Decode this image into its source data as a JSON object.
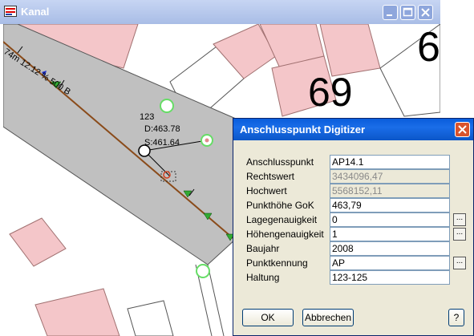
{
  "window": {
    "title": "Kanal",
    "minimize_icon": "minimize-icon",
    "maximize_icon": "maximize-icon",
    "close_icon": "close-icon"
  },
  "map": {
    "house_number_partial": "6",
    "house_number": "69",
    "pipe_label": "74m 12.12 % 500 B",
    "node_label": {
      "id": "123",
      "depth": "D:463.78",
      "sole": "S:461.64"
    },
    "colors": {
      "street": "#c0c0c0",
      "building": "#f4c6c9",
      "pipe": "#8a4b1a",
      "node_circle": "#66dd66"
    }
  },
  "dialog": {
    "title": "Anschlusspunkt Digitizer",
    "close_icon": "close-icon",
    "fields": [
      {
        "label": "Anschlusspunkt",
        "value": "AP14.1",
        "readonly": false,
        "button": ""
      },
      {
        "label": "Rechtswert",
        "value": "3434096,47",
        "readonly": true,
        "button": ""
      },
      {
        "label": "Hochwert",
        "value": "5568152,11",
        "readonly": true,
        "button": ""
      },
      {
        "label": "Punkthöhe GoK",
        "value": "463,79",
        "readonly": false,
        "button": ""
      },
      {
        "label": "Lagegenauigkeit",
        "value": "0",
        "readonly": false,
        "button": "..."
      },
      {
        "label": "Höhengenauigkeit",
        "value": "1",
        "readonly": false,
        "button": "..."
      },
      {
        "label": "Baujahr",
        "value": "2008",
        "readonly": false,
        "button": ""
      },
      {
        "label": "Punktkennung",
        "value": "AP",
        "readonly": false,
        "button": "..."
      },
      {
        "label": "Haltung",
        "value": "123-125",
        "readonly": false,
        "button": ""
      }
    ],
    "ok_label": "OK",
    "cancel_label": "Abbrechen",
    "help_label": "?"
  }
}
